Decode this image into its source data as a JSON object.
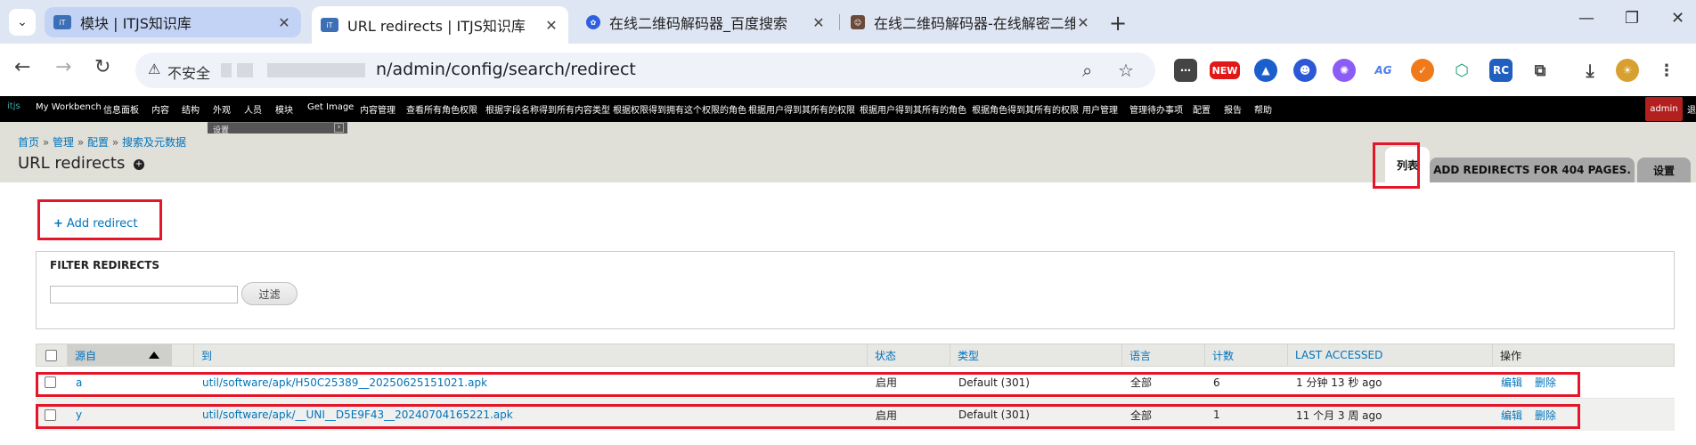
{
  "browser": {
    "tabs": [
      {
        "title": "模块 | ITJS知识库",
        "favicon": "itjs-logo-icon",
        "state": "inactive"
      },
      {
        "title": "URL redirects | ITJS知识库",
        "favicon": "itjs-logo-icon",
        "state": "active"
      },
      {
        "title": "在线二维码解码器_百度搜索",
        "favicon": "baidu-paw-icon",
        "state": "inactive"
      },
      {
        "title": "在线二维码解码器-在线解密二维",
        "favicon": "portrait-icon",
        "state": "inactive"
      }
    ],
    "close_glyph": "✕",
    "new_tab_glyph": "+",
    "window_controls": [
      "—",
      "❐",
      "✕"
    ],
    "omnibox": {
      "security_label": "不安全",
      "url_visible": "n/admin/config/search/redirect"
    },
    "extension_badge": "NEW",
    "extension_labels": [
      "AG",
      "RC"
    ]
  },
  "admin_bar": {
    "logo_text": "itjs",
    "items": [
      "My Workbench",
      "信息面板",
      "内容",
      "结构",
      "外观",
      "人员",
      "模块",
      "Get Image",
      "内容管理",
      "查看所有角色权限",
      "根据字段名称得到所有内容类型",
      "根据权限得到拥有这个权限的角色",
      "根据用户得到其所有的权限",
      "根据用户得到其所有的角色",
      "根据角色得到其所有的权限",
      "用户管理",
      "管理待办事项",
      "配置",
      "报告",
      "帮助"
    ],
    "user": "admin",
    "edge_text": "退",
    "dropdown_label": "设置"
  },
  "header": {
    "breadcrumb": [
      "首页",
      "管理",
      "配置",
      "搜索及元数据"
    ],
    "breadcrumb_sep": "»",
    "title": "URL redirects",
    "tabs": [
      {
        "label": "列表",
        "active": true
      },
      {
        "label": "ADD REDIRECTS FOR 404 PAGES.",
        "active": false
      },
      {
        "label": "设置",
        "active": false
      }
    ]
  },
  "actions": {
    "add_redirect": "Add redirect",
    "add_symbol": "+"
  },
  "filter": {
    "title": "FILTER REDIRECTS",
    "input_value": "",
    "button": "过滤"
  },
  "table": {
    "headers": {
      "source": "源自",
      "to": "到",
      "status": "状态",
      "type": "类型",
      "language": "语言",
      "count": "计数",
      "last_accessed": "LAST ACCESSED",
      "operations": "操作"
    },
    "rows": [
      {
        "source": "a",
        "to": "util/software/apk/H50C25389__20250625151021.apk",
        "status": "启用",
        "type": "Default (301)",
        "language": "全部",
        "count": "6",
        "last_accessed": "1 分钟 13 秒 ago",
        "edit": "编辑",
        "delete": "删除"
      },
      {
        "source": "y",
        "to": "util/software/apk/__UNI__D5E9F43__20240704165221.apk",
        "status": "启用",
        "type": "Default (301)",
        "language": "全部",
        "count": "1",
        "last_accessed": "11 个月 3 周 ago",
        "edit": "编辑",
        "delete": "删除"
      }
    ]
  },
  "colors": {
    "highlight": "#e4172a",
    "link": "#0074bd",
    "admin_bar": "#000000",
    "header_bg": "#e0dfd8"
  }
}
